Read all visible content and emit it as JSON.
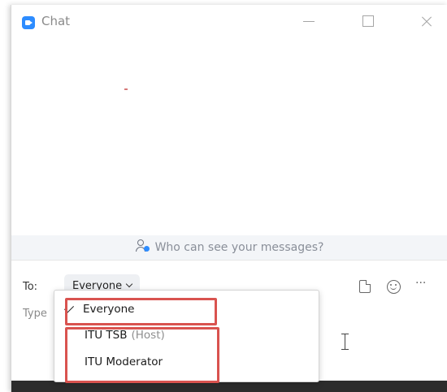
{
  "window": {
    "title": "Chat"
  },
  "privacy": {
    "text": "Who can see your messages?"
  },
  "compose": {
    "to_label": "To:",
    "recipient_selected": "Everyone",
    "input_placeholder": "Type"
  },
  "dropdown": {
    "options": [
      {
        "label": "Everyone",
        "tag": "",
        "selected": true
      },
      {
        "label": "ITU TSB",
        "tag": "(Host)",
        "selected": false
      },
      {
        "label": "ITU Moderator",
        "tag": "",
        "selected": false
      }
    ]
  },
  "colors": {
    "accent": "#2D8CFF",
    "highlight": "#d9534f"
  },
  "icons": {
    "app": "zoom-app-icon",
    "privacy": "people-icon",
    "file": "file-icon",
    "emoji": "emoji-icon",
    "more": "more-options-icon",
    "check": "check-icon",
    "cursor": "text-cursor-icon"
  }
}
